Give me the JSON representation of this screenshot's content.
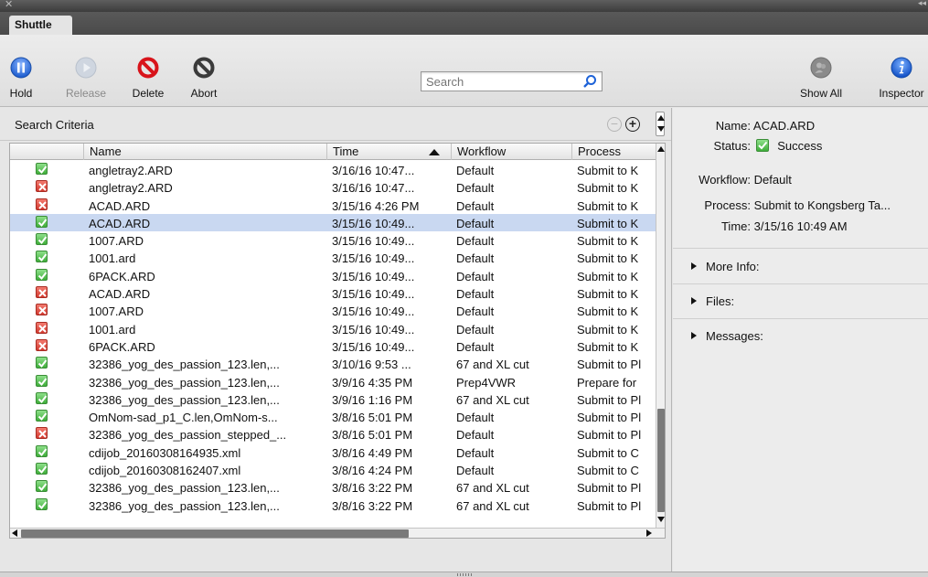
{
  "window": {
    "tab": "Shuttle"
  },
  "toolbar": {
    "hold": "Hold",
    "release": "Release",
    "delete": "Delete",
    "abort": "Abort",
    "show_all": "Show All",
    "inspector": "Inspector",
    "search_placeholder": "Search"
  },
  "criteria": {
    "label": "Search Criteria"
  },
  "table": {
    "headers": {
      "name": "Name",
      "time": "Time",
      "workflow": "Workflow",
      "process": "Process"
    },
    "rows": [
      {
        "status": "ok",
        "name": "angletray2.ARD",
        "time": "3/16/16 10:47...",
        "workflow": "Default",
        "process": "Submit to K"
      },
      {
        "status": "err",
        "name": "angletray2.ARD",
        "time": "3/16/16 10:47...",
        "workflow": "Default",
        "process": "Submit to K"
      },
      {
        "status": "err",
        "name": "ACAD.ARD",
        "time": "3/15/16 4:26 PM",
        "workflow": "Default",
        "process": "Submit to K"
      },
      {
        "status": "ok",
        "name": "ACAD.ARD",
        "time": "3/15/16 10:49...",
        "workflow": "Default",
        "process": "Submit to K",
        "selected": true
      },
      {
        "status": "ok",
        "name": "1007.ARD",
        "time": "3/15/16 10:49...",
        "workflow": "Default",
        "process": "Submit to K"
      },
      {
        "status": "ok",
        "name": "1001.ard",
        "time": "3/15/16 10:49...",
        "workflow": "Default",
        "process": "Submit to K"
      },
      {
        "status": "ok",
        "name": "6PACK.ARD",
        "time": "3/15/16 10:49...",
        "workflow": "Default",
        "process": "Submit to K"
      },
      {
        "status": "err",
        "name": "ACAD.ARD",
        "time": "3/15/16 10:49...",
        "workflow": "Default",
        "process": "Submit to K"
      },
      {
        "status": "err",
        "name": "1007.ARD",
        "time": "3/15/16 10:49...",
        "workflow": "Default",
        "process": "Submit to K"
      },
      {
        "status": "err",
        "name": "1001.ard",
        "time": "3/15/16 10:49...",
        "workflow": "Default",
        "process": "Submit to K"
      },
      {
        "status": "err",
        "name": "6PACK.ARD",
        "time": "3/15/16 10:49...",
        "workflow": "Default",
        "process": "Submit to K"
      },
      {
        "status": "ok",
        "name": "32386_yog_des_passion_123.len,...",
        "time": "3/10/16 9:53 ...",
        "workflow": "67  and XL cut",
        "process": "Submit to Pl"
      },
      {
        "status": "ok",
        "name": "32386_yog_des_passion_123.len,...",
        "time": "3/9/16 4:35 PM",
        "workflow": "Prep4VWR",
        "process": "Prepare for"
      },
      {
        "status": "ok",
        "name": "32386_yog_des_passion_123.len,...",
        "time": "3/9/16 1:16 PM",
        "workflow": "67  and XL cut",
        "process": "Submit to Pl"
      },
      {
        "status": "ok",
        "name": "OmNom-sad_p1_C.len,OmNom-s...",
        "time": "3/8/16 5:01 PM",
        "workflow": "Default",
        "process": "Submit to Pl"
      },
      {
        "status": "err",
        "name": "32386_yog_des_passion_stepped_...",
        "time": "3/8/16 5:01 PM",
        "workflow": "Default",
        "process": "Submit to Pl"
      },
      {
        "status": "ok",
        "name": "cdijob_20160308164935.xml",
        "time": "3/8/16 4:49 PM",
        "workflow": "Default",
        "process": "Submit to C"
      },
      {
        "status": "ok",
        "name": "cdijob_20160308162407.xml",
        "time": "3/8/16 4:24 PM",
        "workflow": "Default",
        "process": "Submit to C"
      },
      {
        "status": "ok",
        "name": "32386_yog_des_passion_123.len,...",
        "time": "3/8/16 3:22 PM",
        "workflow": "67  and XL cut",
        "process": "Submit to Pl"
      },
      {
        "status": "ok",
        "name": "32386_yog_des_passion_123.len,...",
        "time": "3/8/16 3:22 PM",
        "workflow": "67  and XL cut",
        "process": "Submit to Pl"
      }
    ]
  },
  "inspector": {
    "name_key": "Name:",
    "name_val": "ACAD.ARD",
    "status_key": "Status:",
    "status_val": "Success",
    "workflow_key": "Workflow:",
    "workflow_val": "Default",
    "process_key": "Process:",
    "process_val": "Submit to Kongsberg Ta...",
    "time_key": "Time:",
    "time_val": "3/15/16 10:49 AM",
    "more_info": "More Info:",
    "files": "Files:",
    "messages": "Messages:"
  },
  "colors": {
    "ok": "#3fae3a",
    "err": "#d33a2f",
    "selected_row": "#c9d8f1",
    "accent_blue": "#1f6fd8"
  }
}
